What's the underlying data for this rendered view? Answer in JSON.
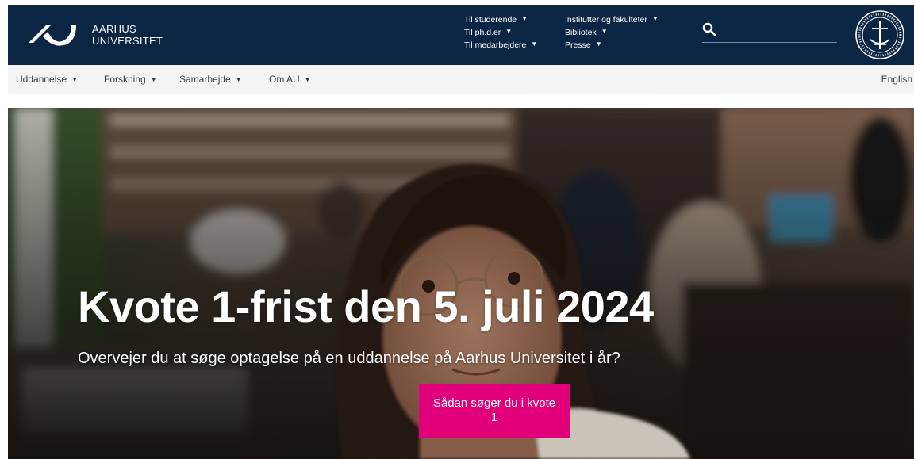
{
  "header": {
    "logo_line1": "AARHUS",
    "logo_line2": "UNIVERSITET",
    "nav_col1": [
      "Til studerende",
      "Til ph.d.er",
      "Til medarbejdere"
    ],
    "nav_col2": [
      "Institutter og fakulteter",
      "Bibliotek",
      "Presse"
    ],
    "search": {
      "value": "",
      "placeholder": ""
    },
    "colors": {
      "bar": "#0b2545",
      "text": "#ffffff"
    }
  },
  "subnav": {
    "items": [
      "Uddannelse",
      "Forskning",
      "Samarbejde",
      "Om AU"
    ],
    "language": "English"
  },
  "hero": {
    "title": "Kvote 1-frist den 5. juli 2024",
    "subtitle": "Overvejer du at søge optagelse på en uddannelse på Aarhus Universitet i år?",
    "cta_label": "Sådan søger du i kvote 1",
    "cta_color": "#e2007a"
  },
  "icons": {
    "search": "search-icon",
    "chevron": "chevron-down-icon",
    "seal": "university-seal-icon",
    "logo": "au-logo-icon"
  }
}
